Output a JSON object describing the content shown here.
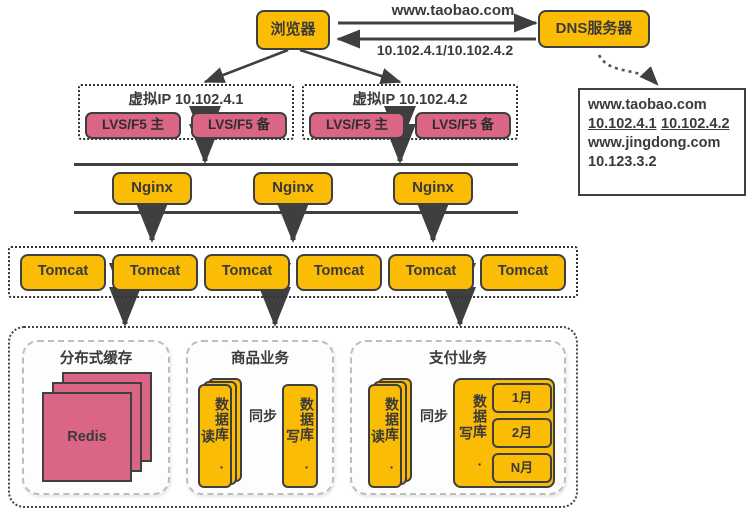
{
  "diagram": {
    "title": "Taobao-style high-availability web architecture",
    "colors": {
      "amber": "#FBBC05",
      "pink": "#DB6585",
      "outline": "#3f3f3f",
      "text": "#3a3a3a"
    }
  },
  "client_tier": {
    "browser": "浏览器",
    "dns_server": "DNS服务器",
    "request_label": "www.taobao.com",
    "response_label": "10.102.4.1/10.102.4.2"
  },
  "dns_table": {
    "rows": [
      {
        "text": "www.taobao.com",
        "underlined": false
      },
      {
        "text": "10.102.4.1",
        "underlined": true
      },
      {
        "text": "10.102.4.2",
        "underlined": true
      },
      {
        "text": "www.jingdong.com",
        "underlined": false
      },
      {
        "text": "10.123.3.2",
        "underlined": false
      }
    ]
  },
  "lb_tier": {
    "groups": [
      {
        "title": "虚拟IP 10.102.4.1",
        "nodes": [
          "LVS/F5 主",
          "LVS/F5 备"
        ]
      },
      {
        "title": "虚拟IP 10.102.4.2",
        "nodes": [
          "LVS/F5 主",
          "LVS/F5 备"
        ]
      }
    ]
  },
  "nginx_tier": {
    "nodes": [
      "Nginx",
      "Nginx",
      "Nginx"
    ]
  },
  "app_tier": {
    "nodes": [
      "Tomcat",
      "Tomcat",
      "Tomcat",
      "Tomcat",
      "Tomcat",
      "Tomcat"
    ]
  },
  "data_tier": {
    "cache_panel": {
      "title": "分布式缓存",
      "node": "Redis",
      "stack_count": 3
    },
    "product_panel": {
      "title": "商品业务",
      "read_db": "数据库 · 读",
      "read_stack_count": 3,
      "write_db": "数据库 · 写",
      "sync_label": "同步"
    },
    "payment_panel": {
      "title": "支付业务",
      "read_db": "数据库 · 读",
      "read_stack_count": 3,
      "write_db": "数据库 · 写",
      "sync_label": "同步",
      "partitions": [
        "1月",
        "2月",
        "N月"
      ]
    }
  }
}
